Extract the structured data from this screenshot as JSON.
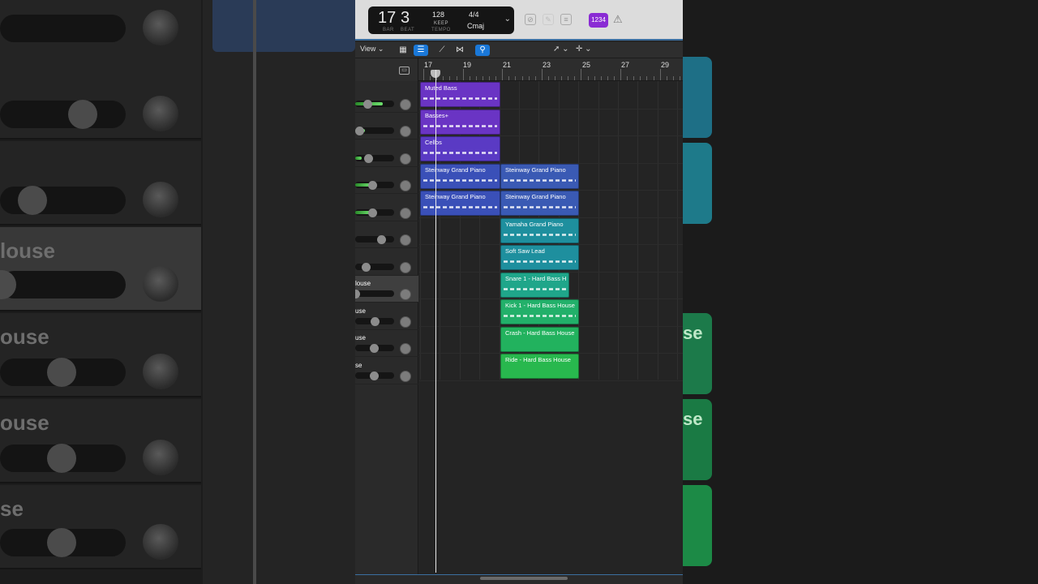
{
  "background": {
    "track_labels": [
      "louse",
      "ouse",
      "ouse",
      "se"
    ],
    "right_labels": [
      "se",
      "se"
    ]
  },
  "transport": {
    "bar": "17",
    "beat": "3",
    "bar_label": "BAR",
    "beat_label": "BEAT",
    "tempo": "128",
    "tempo_mode": "KEEP",
    "tempo_label": "TEMPO",
    "time_signature": "4/4",
    "key": "Cmaj",
    "count_in": "1234"
  },
  "toolbar": {
    "view_label": "View"
  },
  "ruler": {
    "bars": [
      "17",
      "19",
      "21",
      "23",
      "25",
      "27",
      "29"
    ]
  },
  "tracks": [
    {
      "name": "",
      "meter": 0.6
    },
    {
      "name": "",
      "meter": 0.15
    },
    {
      "name": "",
      "meter": 0.12
    },
    {
      "name": "",
      "meter": 0.55
    },
    {
      "name": "",
      "meter": 0.55
    },
    {
      "name": "",
      "meter": 0
    },
    {
      "name": "",
      "meter": 0
    },
    {
      "name": "louse",
      "meter": 0
    },
    {
      "name": "use",
      "meter": 0
    },
    {
      "name": "use",
      "meter": 0
    },
    {
      "name": "se",
      "meter": 0
    }
  ],
  "regions": [
    {
      "label": "Muted Bass",
      "color": "#6a34c4"
    },
    {
      "label": "Basses+",
      "color": "#6a34c4"
    },
    {
      "label": "Cellos",
      "color": "#5a3ac4"
    },
    {
      "label": "Steinway Grand Piano",
      "color": "#3a50b8"
    },
    {
      "label": "Steinway Grand Piano",
      "color": "#3a50b8"
    },
    {
      "label": "Steinway Grand Piano",
      "color": "#3a5ab4"
    },
    {
      "label": "Steinway Grand Piano",
      "color": "#3a5ab4"
    },
    {
      "label": "Yamaha Grand Piano",
      "color": "#1e8f9e"
    },
    {
      "label": "Soft Saw Lead",
      "color": "#1e8f9e"
    },
    {
      "label": "Snare 1 - Hard Bass H",
      "color": "#1fa68a"
    },
    {
      "label": "Kick 1 - Hard Bass House",
      "color": "#22b06a"
    },
    {
      "label": "Crash - Hard Bass House",
      "color": "#22b25e"
    },
    {
      "label": "Ride - Hard Bass House",
      "color": "#28b84e"
    }
  ]
}
